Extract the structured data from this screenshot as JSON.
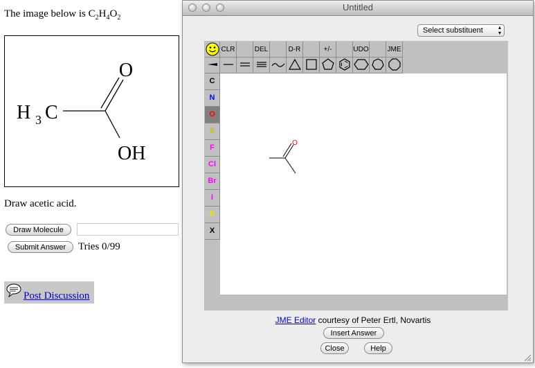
{
  "page": {
    "intro_prefix": "The image below is C",
    "formula_parts": [
      "2",
      "H",
      "4",
      "O",
      "2"
    ],
    "molecule_labels": {
      "o_top": "O",
      "h3c_h": "H",
      "h3c_sub": "3",
      "h3c_c": "C",
      "oh": "OH"
    },
    "prompt": "Draw acetic acid.",
    "draw_button": "Draw Molecule",
    "submit_button": "Submit Answer",
    "answer_value": "",
    "tries": "Tries 0/99",
    "post_discussion": "Post Discussion"
  },
  "window": {
    "title": "Untitled",
    "substituent_select": "Select substituent",
    "toolbar_row1": [
      "CLR",
      "DEL",
      "D-R",
      "+/-",
      "UDO",
      "JME"
    ],
    "atoms": [
      {
        "symbol": "C",
        "color": "#000000"
      },
      {
        "symbol": "N",
        "color": "#0000ff"
      },
      {
        "symbol": "O",
        "color": "#ff0000"
      },
      {
        "symbol": "S",
        "color": "#c8c800"
      },
      {
        "symbol": "F",
        "color": "#ff00ff"
      },
      {
        "symbol": "Cl",
        "color": "#ff00ff"
      },
      {
        "symbol": "Br",
        "color": "#ff00ff"
      },
      {
        "symbol": "I",
        "color": "#ff00ff"
      },
      {
        "symbol": "P",
        "color": "#e6e600"
      },
      {
        "symbol": "X",
        "color": "#000000"
      }
    ],
    "canvas_atom_label": "O",
    "credit_link": "JME Editor",
    "credit_rest": " courtesy of Peter Ertl, Novartis",
    "insert_button": "Insert Answer",
    "close_button": "Close",
    "help_button": "Help"
  },
  "colors": {
    "selected_atom_bg": "#808080",
    "toolbar_bg": "#c0c0c0",
    "link": "#0000cc"
  }
}
